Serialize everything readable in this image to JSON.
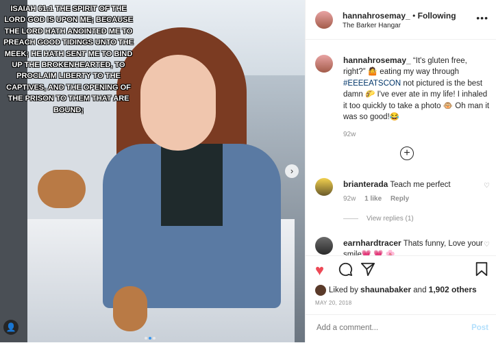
{
  "photo": {
    "overlay_text": "ISAIAH 61:1 THE SPIRIT OF THE LORD GOD IS UPON ME; BECAUSE THE LORD HATH ANOINTED ME TO PREACH GOOD TIDINGS UNTO THE MEEK; HE HATH SENT ME TO BIND UP THE BROKENHEARTED, TO PROCLAIM LIBERTY TO THE CAPTIVES, AND THE OPENING OF THE PRISON TO THEM THAT ARE BOUND;",
    "next_arrow": "›",
    "carousel_dots": 3,
    "active_dot": 1
  },
  "header": {
    "username": "hannahrosemay_",
    "separator": "•",
    "follow_status": "Following",
    "location": "The Barker Hangar",
    "more_icon": "more-options-icon"
  },
  "caption": {
    "username": "hannahrosemay_",
    "text_1": "“It's gluten free, right?” 🤷 eating my way through ",
    "hashtag": "#EEEEATSCON",
    "text_2": " not pictured is the best damn 🌮 I've ever ate in my life! I inhaled it too quickly to take a photo 🐵 Oh man it was so good!😂",
    "time": "92w"
  },
  "comments": [
    {
      "username": "brianterada",
      "text": "Teach me perfect",
      "time": "92w",
      "likes": "1 like",
      "reply": "Reply"
    },
    {
      "username": "earnhardtracer",
      "text": "Thats funny, Love your smile💗 💗 🌸"
    }
  ],
  "view_replies": "View replies (1)",
  "actions": {
    "like_icon": "heart-icon",
    "comment_icon": "comment-icon",
    "share_icon": "share-icon",
    "save_icon": "bookmark-icon"
  },
  "likes": {
    "prefix": "Liked by ",
    "user": "shaunabaker",
    "middle": " and ",
    "count": "1,902 others"
  },
  "date": "MAY 20, 2018",
  "add_comment": {
    "placeholder": "Add a comment...",
    "post_label": "Post"
  },
  "colors": {
    "like_red": "#ed4956",
    "link_blue": "#003569",
    "post_disabled": "#b2dffc"
  }
}
